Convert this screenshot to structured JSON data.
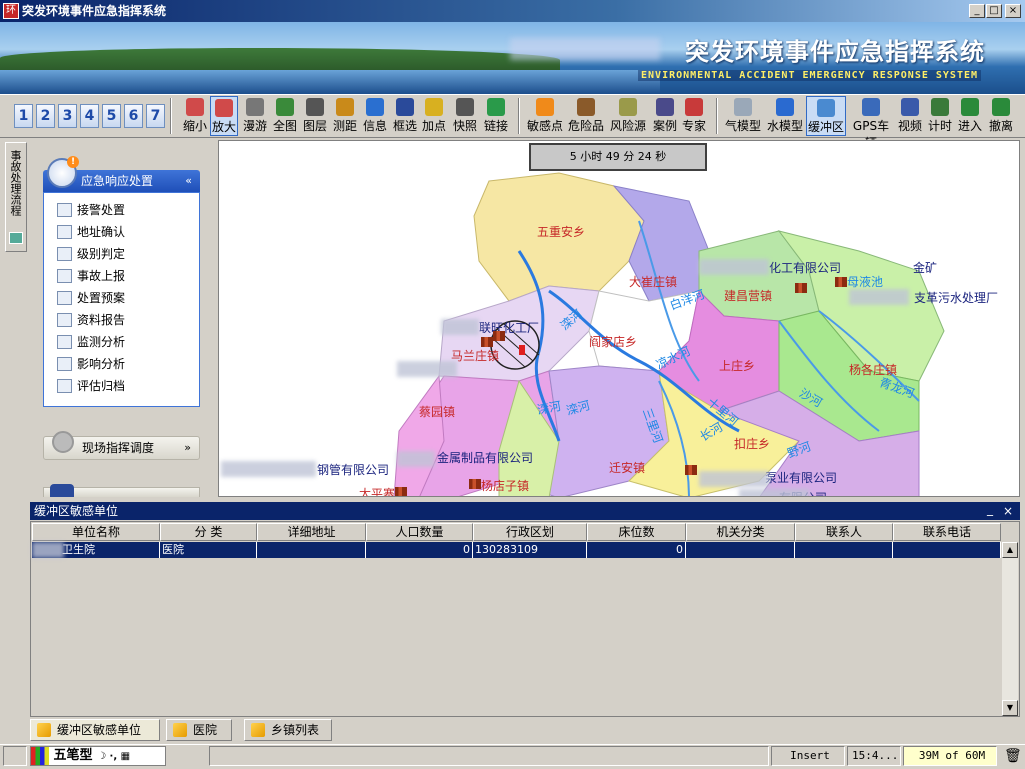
{
  "window": {
    "title": "突发环境事件应急指挥系统",
    "min": "_",
    "max": "□",
    "close": "×"
  },
  "banner": {
    "title": "突发环境事件应急指挥系统",
    "subtitle": "ENVIRONMENTAL ACCIDENT EMERGENCY RESPONSE SYSTEM"
  },
  "toolbar": {
    "numbers": [
      "1",
      "2",
      "3",
      "4",
      "5",
      "6",
      "7"
    ],
    "tools": [
      {
        "label": "缩小",
        "icon": "zoom-out-icon",
        "color": "#d04a4a"
      },
      {
        "label": "放大",
        "icon": "zoom-in-icon",
        "color": "#d04a4a",
        "active": true
      },
      {
        "label": "漫游",
        "icon": "pan-hand-icon",
        "color": "#777"
      },
      {
        "label": "全图",
        "icon": "globe-icon",
        "color": "#3a8a3a"
      },
      {
        "label": "图层",
        "icon": "eye-icon",
        "color": "#555"
      },
      {
        "label": "测距",
        "icon": "ruler-icon",
        "color": "#c98a1a"
      },
      {
        "label": "信息",
        "icon": "info-icon",
        "color": "#2a6fd0"
      },
      {
        "label": "框选",
        "icon": "box-select-icon",
        "color": "#2a4a9a"
      },
      {
        "label": "加点",
        "icon": "add-point-icon",
        "color": "#d8b020"
      },
      {
        "label": "快照",
        "icon": "camera-icon",
        "color": "#555"
      },
      {
        "label": "链接",
        "icon": "link-icon",
        "color": "#2a9a4a"
      },
      {
        "label": "敏感点",
        "icon": "rss-icon",
        "color": "#f08a1a"
      },
      {
        "label": "危险品",
        "icon": "hazard-icon",
        "color": "#8a5a2a"
      },
      {
        "label": "风险源",
        "icon": "risk-source-icon",
        "color": "#9a9a4a"
      },
      {
        "label": "案例",
        "icon": "case-icon",
        "color": "#4a4a8a"
      },
      {
        "label": "专家",
        "icon": "expert-icon",
        "color": "#c83a3a"
      },
      {
        "label": "气模型",
        "icon": "cloud-icon",
        "color": "#9aa8b8"
      },
      {
        "label": "水模型",
        "icon": "water-model-icon",
        "color": "#2a6ad0"
      },
      {
        "label": "缓冲区",
        "icon": "buffer-icon",
        "color": "#4a8ad0",
        "active": true
      },
      {
        "label": "GPS车辆",
        "icon": "car-icon",
        "color": "#3a6aba"
      },
      {
        "label": "视频",
        "icon": "video-icon",
        "color": "#3a5aaa"
      },
      {
        "label": "计时",
        "icon": "timer-icon",
        "color": "#3a7a3a"
      },
      {
        "label": "进入",
        "icon": "enter-icon",
        "color": "#2a8a3a"
      },
      {
        "label": "撤离",
        "icon": "exit-icon",
        "color": "#2a8a3a"
      }
    ]
  },
  "sidetab": {
    "label": "事故处理流程"
  },
  "leftpanel": {
    "header": "应急响应处置",
    "badge": "!",
    "collapse": "«",
    "items": [
      "接警处置",
      "地址确认",
      "级别判定",
      "事故上报",
      "处置预案",
      "资料报告",
      "监测分析",
      "影响分析",
      "评估归档"
    ],
    "section2": "现场指挥调度",
    "expand2": "»"
  },
  "map": {
    "timer": "5 小时 49 分 24 秒",
    "labels": [
      {
        "text": "五重安乡",
        "color": "#c62828"
      },
      {
        "text": "大崔庄镇",
        "color": "#c62828"
      },
      {
        "text": "化工有限公司",
        "color": "#1a237e"
      },
      {
        "text": "金矿",
        "color": "#1a237e"
      },
      {
        "text": "建昌营镇",
        "color": "#c62828"
      },
      {
        "text": "支革污水处理厂",
        "color": "#1a237e"
      },
      {
        "text": "白洋河",
        "color": "#1e88e5"
      },
      {
        "text": "联旺化工厂",
        "color": "#1a237e"
      },
      {
        "text": "阎家店乡",
        "color": "#c62828"
      },
      {
        "text": "马兰庄镇",
        "color": "#c62828"
      },
      {
        "text": "上庄乡",
        "color": "#c62828"
      },
      {
        "text": "杨各庄镇",
        "color": "#c62828"
      },
      {
        "text": "蔡园镇",
        "color": "#c62828"
      },
      {
        "text": "沙河",
        "color": "#1e88e5"
      },
      {
        "text": "青龙河",
        "color": "#1e88e5"
      },
      {
        "text": "金属制品有限公司",
        "color": "#1a237e"
      },
      {
        "text": "钢管有限公司",
        "color": "#1a237e"
      },
      {
        "text": "迁安镇",
        "color": "#c62828"
      },
      {
        "text": "扣庄乡",
        "color": "#c62828"
      },
      {
        "text": "泵业有限公司",
        "color": "#1a237e"
      },
      {
        "text": "杨店子镇",
        "color": "#c62828"
      },
      {
        "text": "太平寨乡",
        "color": "#c62828"
      },
      {
        "text": "滦河",
        "color": "#1e88e5"
      },
      {
        "text": "滦河",
        "color": "#1e88e5"
      },
      {
        "text": "三里河",
        "color": "#1e88e5"
      },
      {
        "text": "凉水河",
        "color": "#1e88e5"
      },
      {
        "text": "野河",
        "color": "#1e88e5"
      },
      {
        "text": "长河",
        "color": "#1e88e5"
      },
      {
        "text": "母液池",
        "color": "#1e88e5"
      },
      {
        "text": "滦河",
        "color": "#1e88e5"
      },
      {
        "text": "十里河",
        "color": "#1e88e5"
      },
      {
        "text": "有限公司",
        "color": "#1a237e"
      }
    ]
  },
  "bottom": {
    "title": "缓冲区敏感单位",
    "min": "_",
    "close": "×",
    "columns": [
      "单位名称",
      "分  类",
      "详细地址",
      "人口数量",
      "行政区划",
      "床位数",
      "机关分类",
      "联系人",
      "联系电话"
    ],
    "rows": [
      [
        "卫生院",
        "医院",
        "",
        "0",
        "130283109",
        "0",
        "",
        "",
        ""
      ]
    ],
    "tabs": [
      "缓冲区敏感单位",
      "医院",
      "乡镇列表"
    ]
  },
  "status": {
    "ime": "五笔型",
    "ime_extra": "☽ ·, ▦",
    "mode": "Insert",
    "time": "15:4...",
    "memory": "39M of 60M"
  }
}
